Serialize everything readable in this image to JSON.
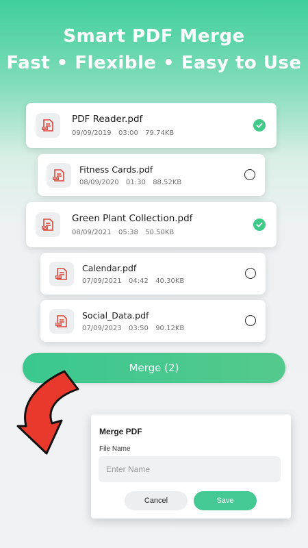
{
  "header": {
    "line1": "Smart PDF Merge",
    "line2": "Fast • Flexible • Easy to Use"
  },
  "files": [
    {
      "name": "PDF Reader.pdf",
      "date": "09/09/2019",
      "time": "03:00",
      "size": "79.74KB",
      "selected": true
    },
    {
      "name": "Fitness Cards.pdf",
      "date": "08/09/2020",
      "time": "01:30",
      "size": "88.52KB",
      "selected": false
    },
    {
      "name": "Green Plant Collection.pdf",
      "date": "08/09/2021",
      "time": "05:38",
      "size": "50.50KB",
      "selected": true
    },
    {
      "name": "Calendar.pdf",
      "date": "07/09/2021",
      "time": "04:42",
      "size": "40.30KB",
      "selected": false
    },
    {
      "name": "Social_Data.pdf",
      "date": "07/09/2023",
      "time": "03:50",
      "size": "90.12KB",
      "selected": false
    }
  ],
  "merge_button": {
    "label": "Merge (2)"
  },
  "dialog": {
    "title": "Merge PDF",
    "field_label": "File Name",
    "placeholder": "Enter Name",
    "cancel_label": "Cancel",
    "save_label": "Save"
  },
  "colors": {
    "accent": "#41c98a",
    "pdf_icon": "#e0463a",
    "arrow": "#e8392c"
  },
  "icons": {
    "file": "pdf-file-icon",
    "selected": "check-circle-icon",
    "unselected": "radio-circle-icon",
    "arrow": "curved-arrow-icon"
  }
}
